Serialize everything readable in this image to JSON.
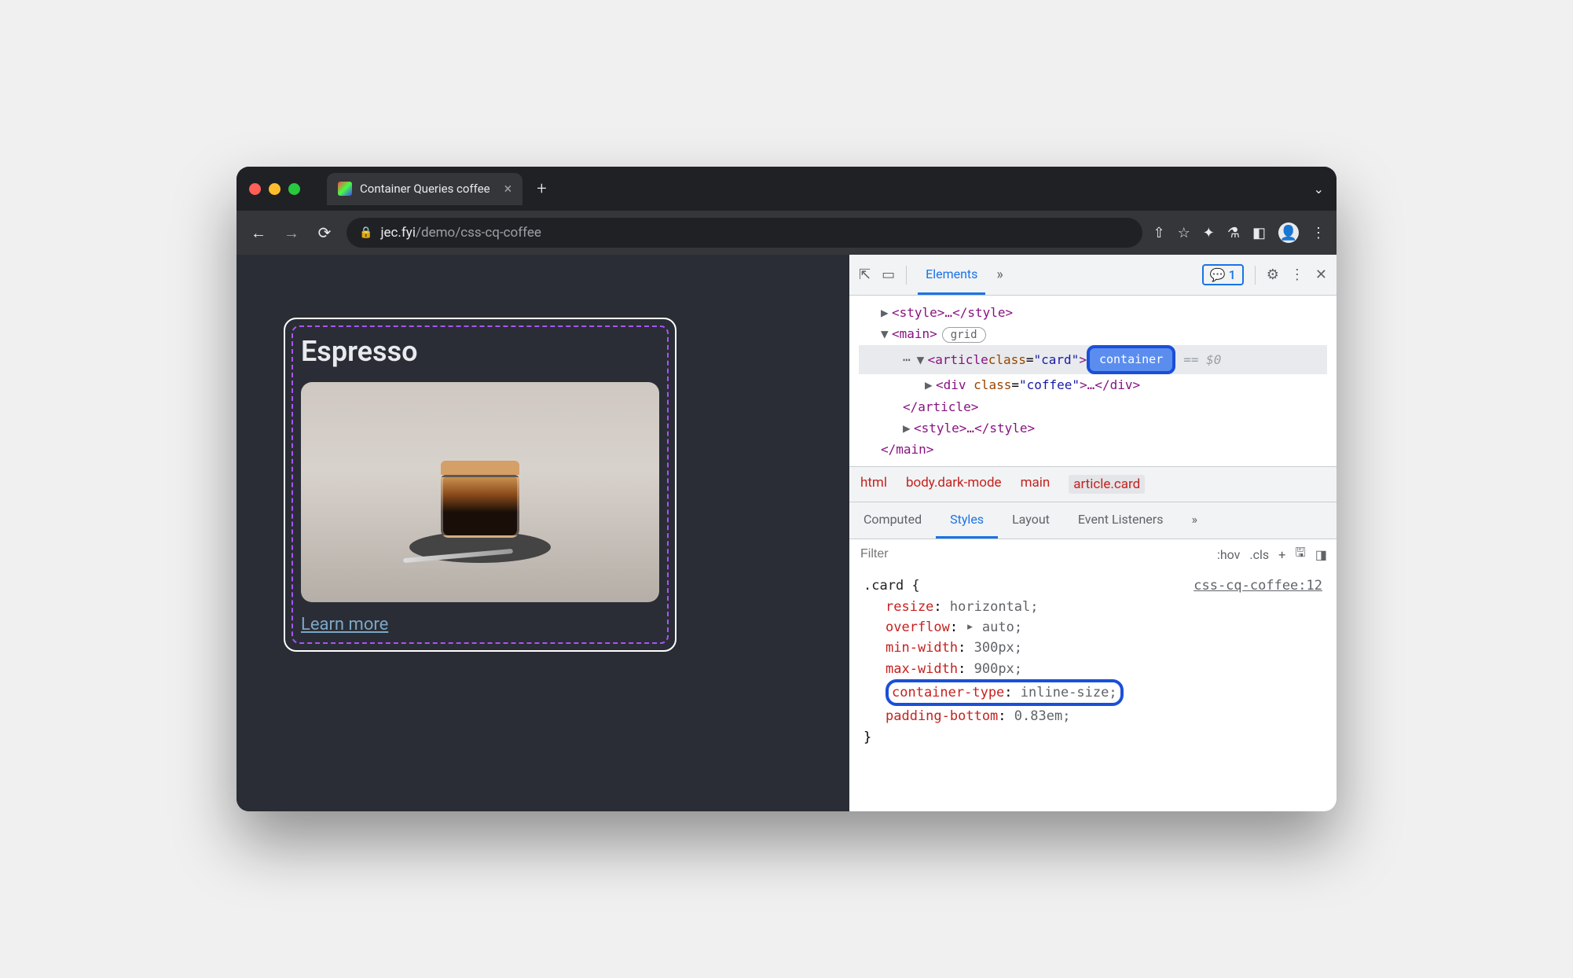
{
  "window": {
    "tab_title": "Container Queries coffee",
    "url_domain": "jec.fyi",
    "url_path": "/demo/css-cq-coffee"
  },
  "page": {
    "card_title": "Espresso",
    "learn_more": "Learn more"
  },
  "devtools": {
    "panel_active": "Elements",
    "issues_count": "1",
    "dom": {
      "style_tag": "<style>…</style>",
      "main_open": "<main>",
      "main_badge": "grid",
      "article_open_a": "<article ",
      "article_attr_name": "class",
      "article_attr_val": "\"card\"",
      "article_open_b": ">",
      "container_badge": "container",
      "eq_dollar": "== $0",
      "div_open_a": "<div ",
      "div_attr_name": "class",
      "div_attr_val": "\"coffee\"",
      "div_open_b": ">…</div>",
      "article_close": "</article>",
      "style_tag2": "<style>…</style>",
      "main_close": "</main>"
    },
    "breadcrumb": [
      "html",
      "body.dark-mode",
      "main",
      "article.card"
    ],
    "styles_tabs": [
      "Computed",
      "Styles",
      "Layout",
      "Event Listeners"
    ],
    "filter_placeholder": "Filter",
    "filter_buttons": {
      "hov": ":hov",
      "cls": ".cls",
      "plus": "+"
    },
    "rule": {
      "selector": ".card {",
      "source": "css-cq-coffee:12",
      "props": [
        {
          "name": "resize",
          "value": "horizontal;"
        },
        {
          "name": "overflow",
          "value": "auto;",
          "expandable": true
        },
        {
          "name": "min-width",
          "value": "300px;"
        },
        {
          "name": "max-width",
          "value": "900px;"
        },
        {
          "name": "container-type",
          "value": "inline-size;",
          "highlight": true
        },
        {
          "name": "padding-bottom",
          "value": "0.83em;"
        }
      ],
      "close": "}"
    }
  }
}
